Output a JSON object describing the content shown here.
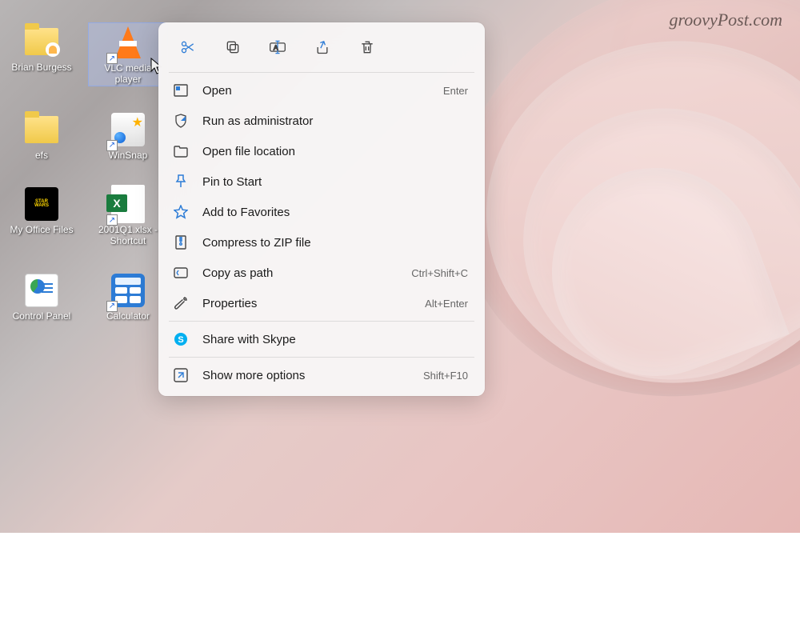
{
  "watermark": "groovyPost.com",
  "desktop_icons": [
    {
      "id": "user-folder",
      "label": "Brian Burgess"
    },
    {
      "id": "vlc",
      "label": "VLC media player",
      "selected": true
    },
    {
      "id": "efs-folder",
      "label": "efs"
    },
    {
      "id": "winsnap",
      "label": "WinSnap"
    },
    {
      "id": "office-folder",
      "label": "My Office Files"
    },
    {
      "id": "excel-shortcut",
      "label": "2001Q1.xlsx - Shortcut"
    },
    {
      "id": "control-panel",
      "label": "Control Panel"
    },
    {
      "id": "calculator",
      "label": "Calculator"
    }
  ],
  "toolbar": {
    "cut": "Cut",
    "copy": "Copy",
    "rename": "Rename",
    "share": "Share",
    "delete": "Delete"
  },
  "menu": {
    "open": {
      "label": "Open",
      "shortcut": "Enter"
    },
    "run_admin": {
      "label": "Run as administrator"
    },
    "open_location": {
      "label": "Open file location"
    },
    "pin_start": {
      "label": "Pin to Start"
    },
    "favorites": {
      "label": "Add to Favorites"
    },
    "compress": {
      "label": "Compress to ZIP file"
    },
    "copy_path": {
      "label": "Copy as path",
      "shortcut": "Ctrl+Shift+C"
    },
    "properties": {
      "label": "Properties",
      "shortcut": "Alt+Enter"
    },
    "skype": {
      "label": "Share with Skype"
    },
    "more": {
      "label": "Show more options",
      "shortcut": "Shift+F10"
    }
  },
  "colors": {
    "accent": "#2d7cd6",
    "menu_bg": "#f8f6f6",
    "text": "#1a1a1a"
  }
}
